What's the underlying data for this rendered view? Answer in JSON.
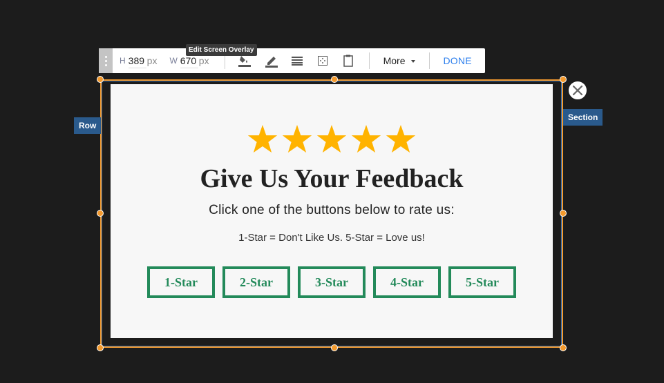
{
  "toolbar": {
    "height_label": "H",
    "height_value": "389",
    "width_label": "W",
    "width_value": "670",
    "unit": "px",
    "tooltip": "Edit Screen Overlay",
    "icons": [
      "fill-color-icon",
      "pencil-icon",
      "lines-icon",
      "spacing-icon",
      "clipboard-icon"
    ],
    "more_label": "More",
    "done_label": "DONE"
  },
  "selection": {
    "row_label": "Row",
    "section_label": "Section",
    "frame_color": "#f39a2e",
    "tag_color": "#2a5a8c"
  },
  "card": {
    "star_count": 5,
    "star_color": "#ffb300",
    "title": "Give Us Your Feedback",
    "subtitle": "Click one of the buttons below to rate us:",
    "legend": "1-Star = Don't Like Us. 5-Star = Love us!",
    "button_color": "#238a5a",
    "buttons": [
      {
        "label": "1-Star"
      },
      {
        "label": "2-Star"
      },
      {
        "label": "3-Star"
      },
      {
        "label": "4-Star"
      },
      {
        "label": "5-Star"
      }
    ]
  }
}
